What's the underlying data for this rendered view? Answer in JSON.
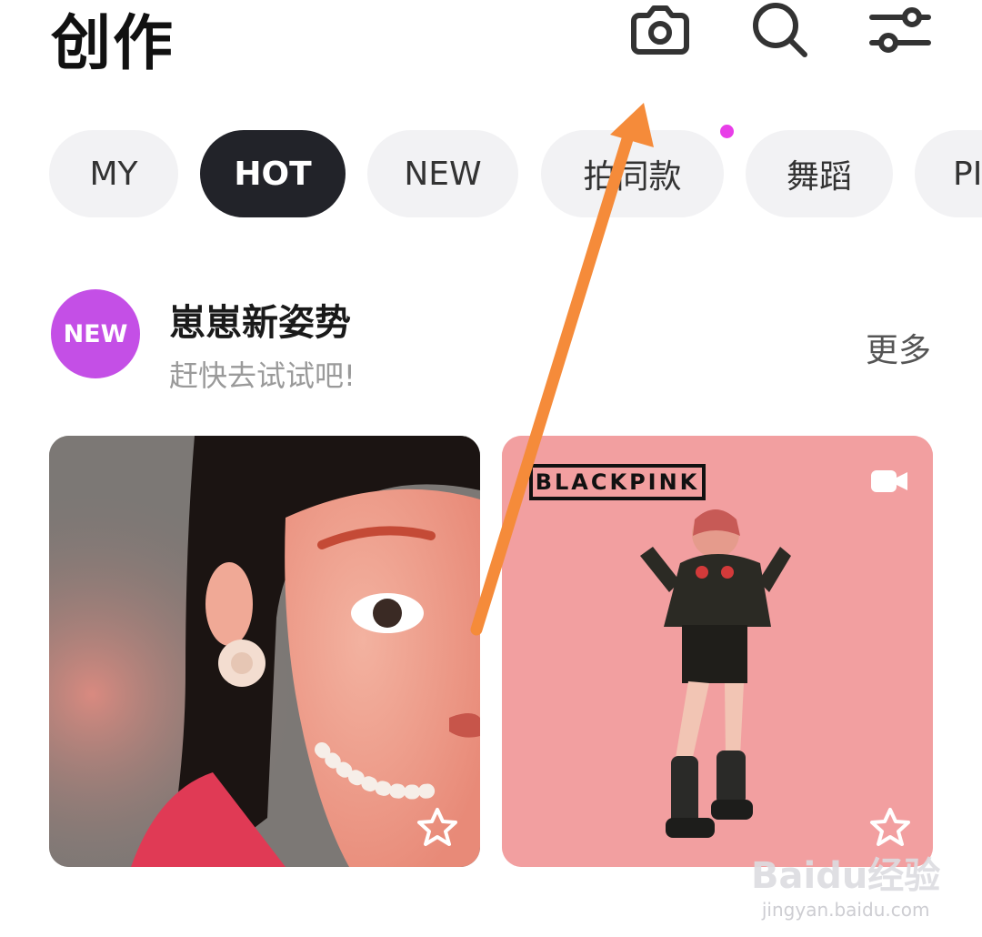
{
  "header": {
    "title": "创作"
  },
  "tabs": [
    {
      "label": "MY"
    },
    {
      "label": "HOT"
    },
    {
      "label": "NEW"
    },
    {
      "label": "拍同款"
    },
    {
      "label": "舞蹈"
    },
    {
      "label": "PI"
    }
  ],
  "active_tab": "HOT",
  "section": {
    "badge": "NEW",
    "title": "崽崽新姿势",
    "subtitle": "赶快去试试吧!",
    "more": "更多"
  },
  "cards": [
    {
      "icon": "star-outline-icon"
    },
    {
      "logo_text": "BLACKPINK",
      "icon": "star-outline-icon",
      "badge_icon": "video-camera-icon"
    }
  ],
  "watermark": {
    "brand": "Baidu经验",
    "url": "jingyan.baidu.com"
  },
  "colors": {
    "accent": "#c44fe6",
    "active_chip": "#222329",
    "chip_bg": "#f2f2f4",
    "dot": "#e83ee8",
    "arrow": "#f58b3a"
  }
}
